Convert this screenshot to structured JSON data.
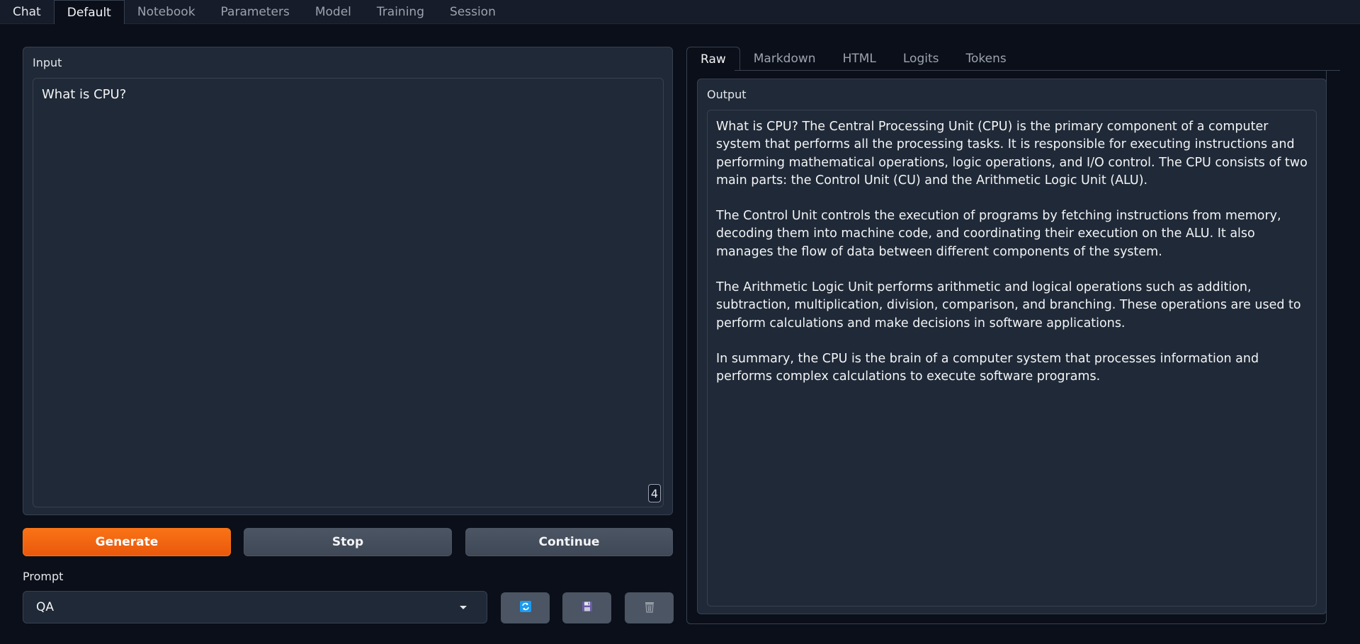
{
  "top_tabs": [
    "Chat",
    "Default",
    "Notebook",
    "Parameters",
    "Model",
    "Training",
    "Session"
  ],
  "active_top_tab": "Default",
  "input": {
    "label": "Input",
    "value": "What is CPU?",
    "token_count": "4"
  },
  "buttons": {
    "generate": "Generate",
    "stop": "Stop",
    "continue": "Continue"
  },
  "prompt": {
    "label": "Prompt",
    "selected": "QA"
  },
  "icons": {
    "refresh": "refresh-icon",
    "save": "save-icon",
    "delete": "trash-icon"
  },
  "output_tabs": [
    "Raw",
    "Markdown",
    "HTML",
    "Logits",
    "Tokens"
  ],
  "active_output_tab": "Raw",
  "output": {
    "label": "Output",
    "paragraphs": [
      "What is CPU? The Central Processing Unit (CPU) is the primary component of a computer system that performs all the processing tasks. It is responsible for executing instructions and performing mathematical operations, logic operations, and I/O control. The CPU consists of two main parts: the Control Unit (CU) and the Arithmetic Logic Unit (ALU).",
      "The Control Unit controls the execution of programs by fetching instructions from memory, decoding them into machine code, and coordinating their execution on the ALU. It also manages the flow of data between different components of the system.",
      "The Arithmetic Logic Unit performs arithmetic and logical operations such as addition, subtraction, multiplication, division, comparison, and branching. These operations are used to perform calculations and make decisions in software applications.",
      "In summary, the CPU is the brain of a computer system that processes information and performs complex calculations to execute software programs."
    ]
  },
  "colors": {
    "background": "#0b0f19",
    "panel": "#1f2937",
    "border": "#374151",
    "accent": "#f97316"
  }
}
